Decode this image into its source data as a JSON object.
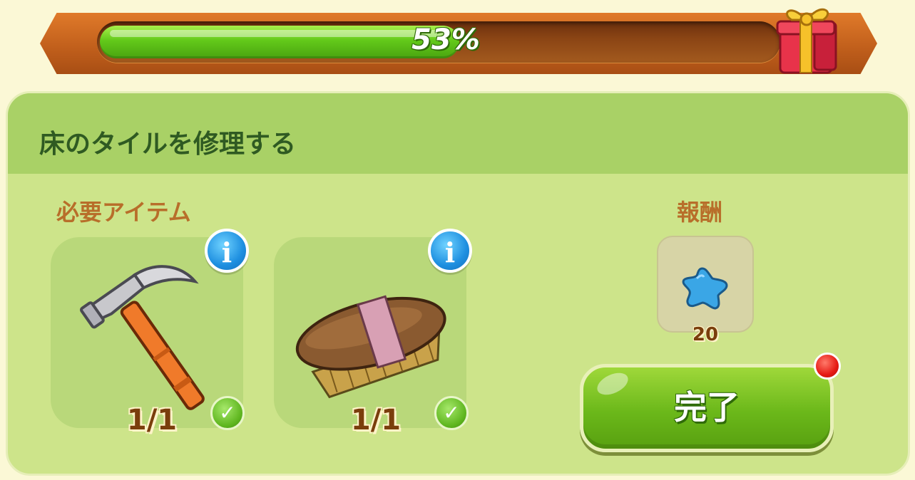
{
  "progress": {
    "percent_text": "53%",
    "value": 0.53
  },
  "task": {
    "title": "床のタイルを修理する"
  },
  "required": {
    "label": "必要アイテム",
    "items": [
      {
        "icon": "hammer-icon",
        "count": "1/1",
        "complete": true
      },
      {
        "icon": "scrub-brush-icon",
        "count": "1/1",
        "complete": true
      }
    ]
  },
  "reward": {
    "label": "報酬",
    "icon": "blue-star-icon",
    "amount": "20"
  },
  "actions": {
    "complete_label": "完了"
  },
  "colors": {
    "progress_fill": "#63c91a",
    "frame": "#c2601c",
    "panel": "#cde48a",
    "header": "#a9d166",
    "title_text": "#2f5a22",
    "label_text": "#b86e2a",
    "info_blue": "#1e8fe0",
    "notification_red": "#e61a14"
  }
}
